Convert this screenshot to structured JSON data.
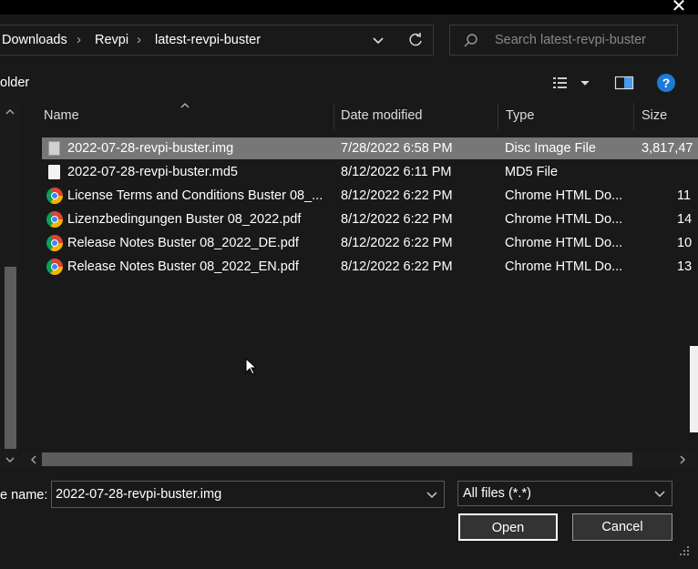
{
  "window": {
    "close_glyph": "✕"
  },
  "breadcrumb": [
    "Downloads",
    "Revpi",
    "latest-revpi-buster"
  ],
  "search": {
    "placeholder": "Search latest-revpi-buster"
  },
  "toolbar": {
    "new_folder_partial": "older",
    "help": "?"
  },
  "columns": {
    "name": "Name",
    "date": "Date modified",
    "type": "Type",
    "size": "Size"
  },
  "files": [
    {
      "name": "2022-07-28-revpi-buster.img",
      "date": "7/28/2022 6:58 PM",
      "type": "Disc Image File",
      "size": "3,817,47",
      "icon": "disc-image-icon",
      "selected": true
    },
    {
      "name": "2022-07-28-revpi-buster.md5",
      "date": "8/12/2022 6:11 PM",
      "type": "MD5 File",
      "size": "",
      "icon": "file-icon",
      "selected": false
    },
    {
      "name": "License Terms and Conditions Buster 08_...",
      "date": "8/12/2022 6:22 PM",
      "type": "Chrome HTML Do...",
      "size": "11",
      "icon": "chrome-icon",
      "selected": false
    },
    {
      "name": "Lizenzbedingungen Buster 08_2022.pdf",
      "date": "8/12/2022 6:22 PM",
      "type": "Chrome HTML Do...",
      "size": "14",
      "icon": "chrome-icon",
      "selected": false
    },
    {
      "name": "Release Notes Buster 08_2022_DE.pdf",
      "date": "8/12/2022 6:22 PM",
      "type": "Chrome HTML Do...",
      "size": "10",
      "icon": "chrome-icon",
      "selected": false
    },
    {
      "name": "Release Notes Buster 08_2022_EN.pdf",
      "date": "8/12/2022 6:22 PM",
      "type": "Chrome HTML Do...",
      "size": "13",
      "icon": "chrome-icon",
      "selected": false
    }
  ],
  "footer": {
    "filename_label": "e name:",
    "filename_value": "2022-07-28-revpi-buster.img",
    "filetype_value": "All files (*.*)",
    "open": "Open",
    "cancel": "Cancel"
  }
}
